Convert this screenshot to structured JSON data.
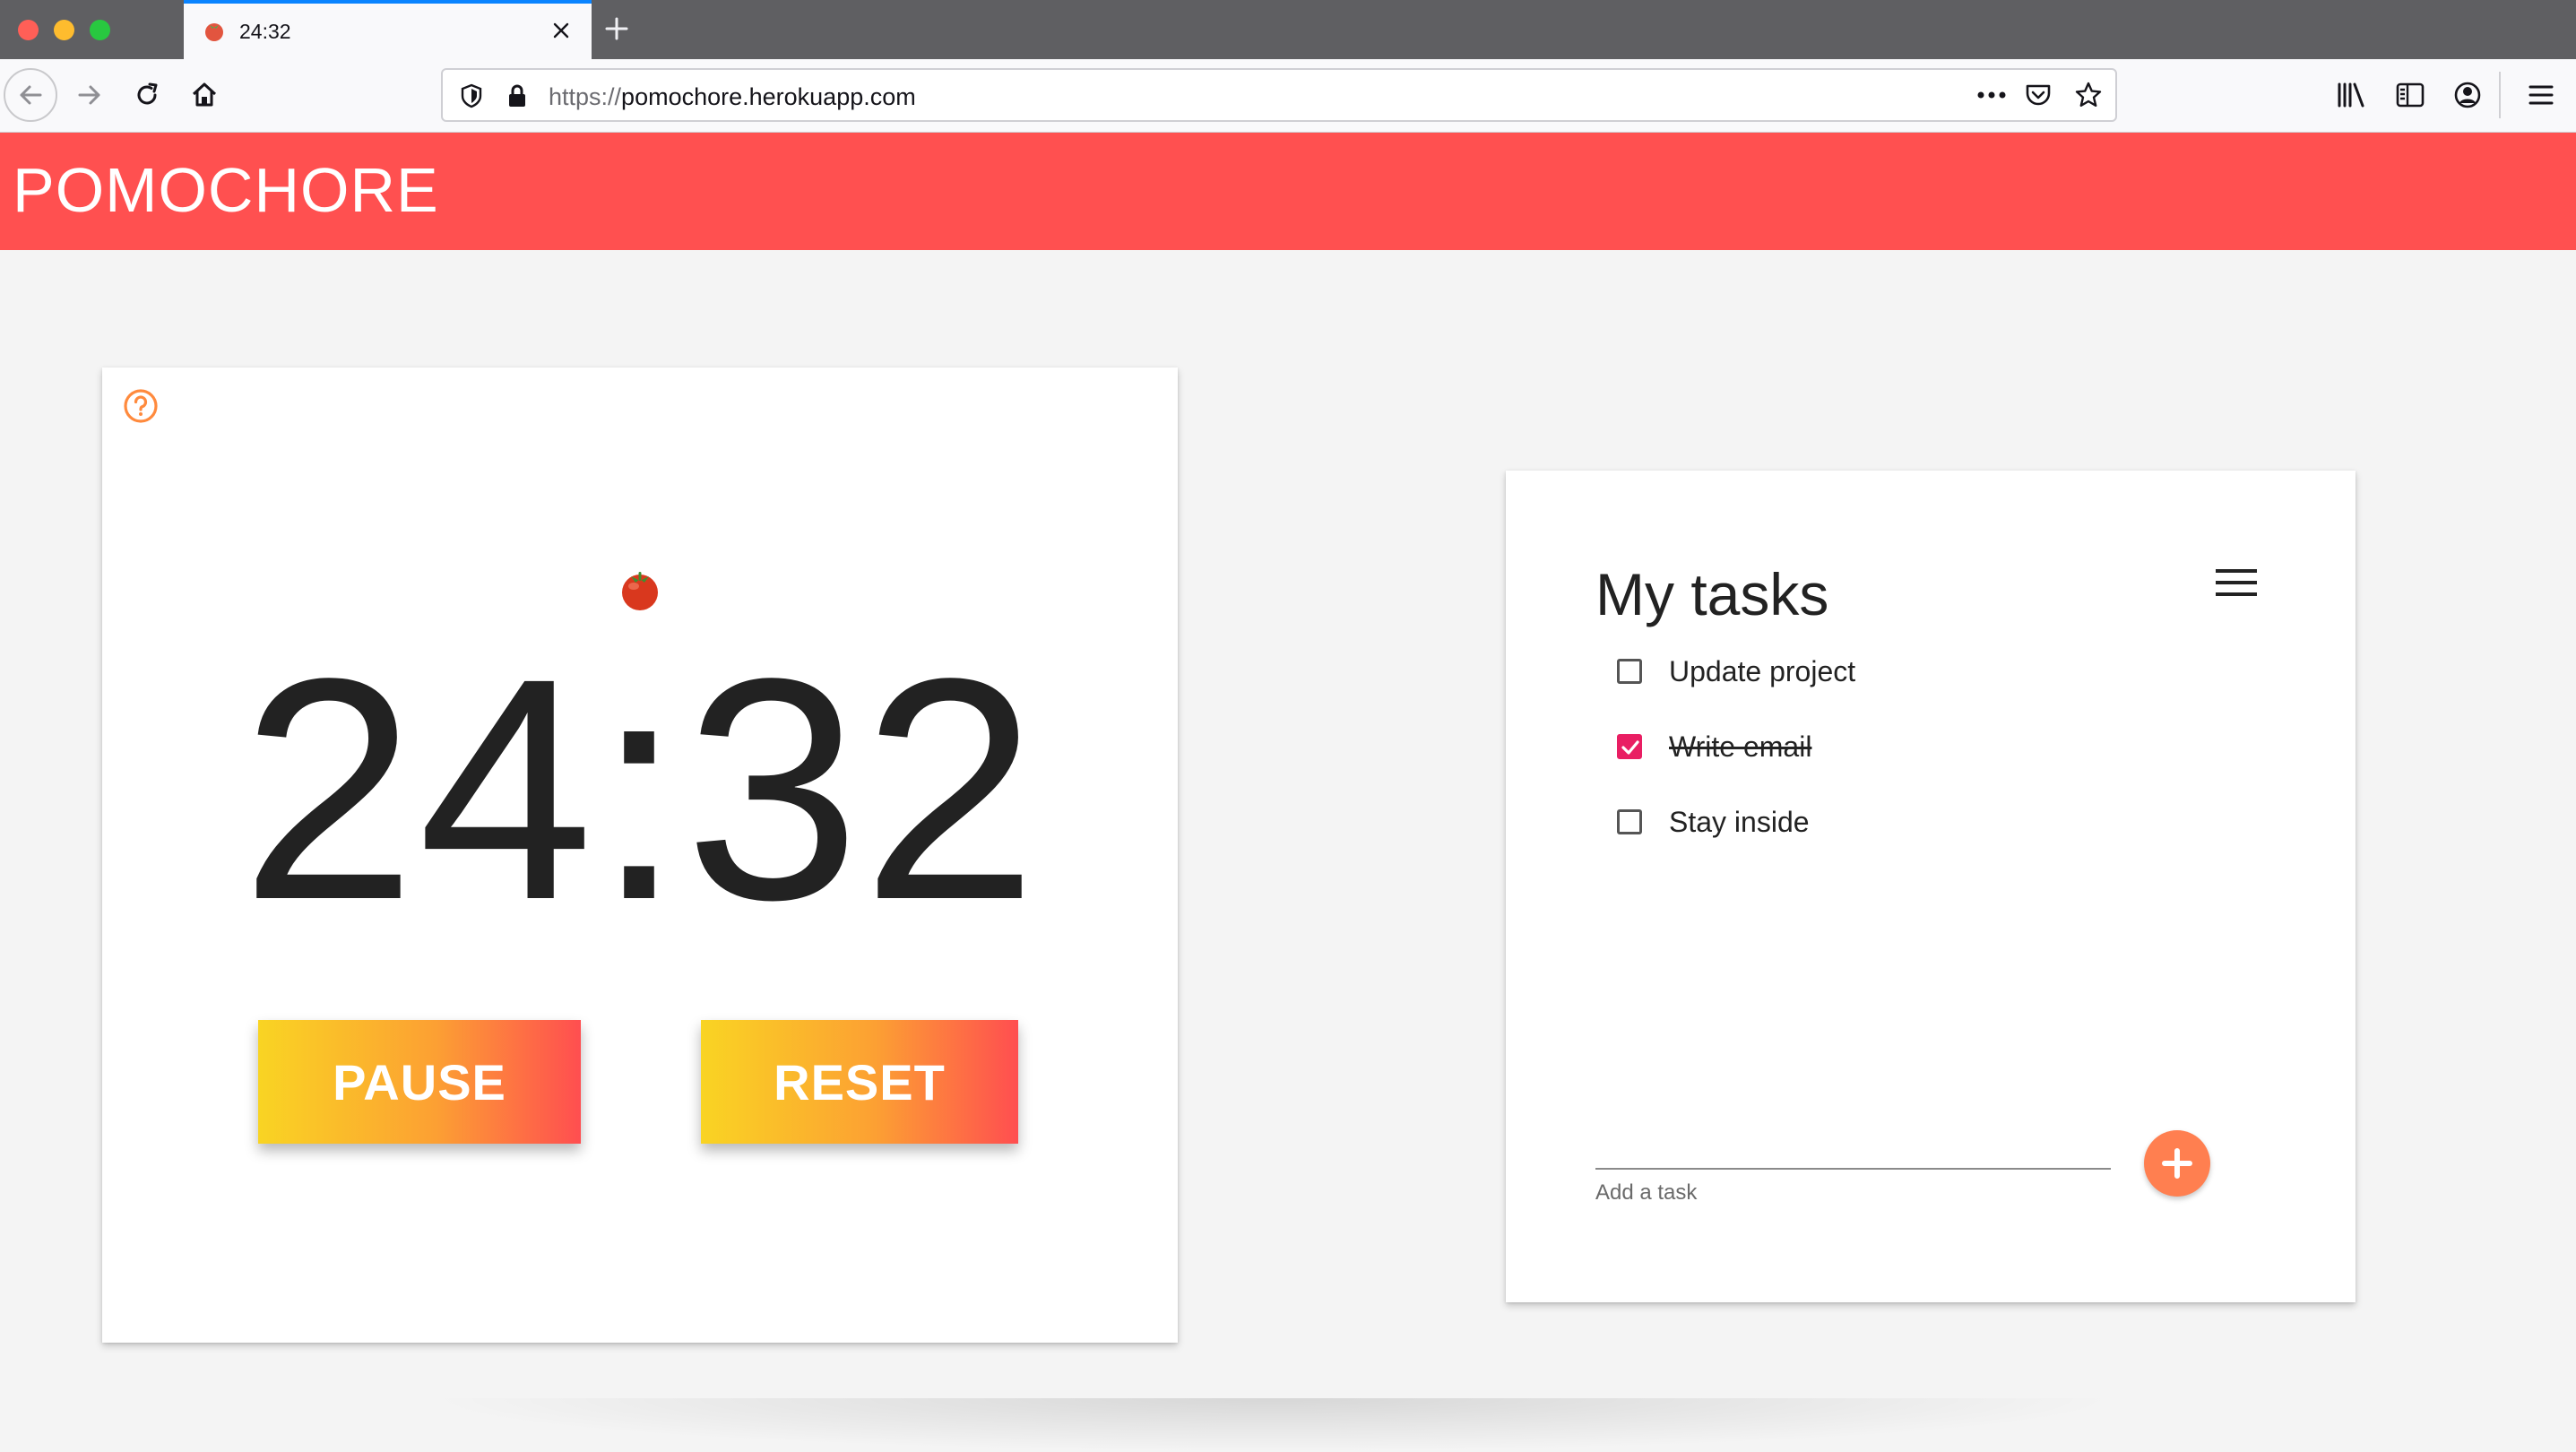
{
  "browser": {
    "tab_title": "24:32",
    "url_scheme": "https://",
    "url_host": "pomochore.herokuapp.com",
    "tab_accent_color": "#0a84ff"
  },
  "app": {
    "title": "POMOCHORE",
    "header_color": "#ff5050"
  },
  "timer": {
    "display": "24:32",
    "help_icon": "question-circle-icon",
    "mode_icon": "tomato-icon",
    "pause_label": "PAUSE",
    "reset_label": "RESET",
    "button_gradient": [
      "#f9d423",
      "#fca033",
      "#ff4e50"
    ]
  },
  "tasks": {
    "title": "My tasks",
    "items": [
      {
        "label": "Update project",
        "done": false
      },
      {
        "label": "Write email",
        "done": true
      },
      {
        "label": "Stay inside",
        "done": false
      }
    ],
    "add_label": "Add a task",
    "add_button_color": "#ff7f50",
    "check_color": "#e91e63"
  }
}
